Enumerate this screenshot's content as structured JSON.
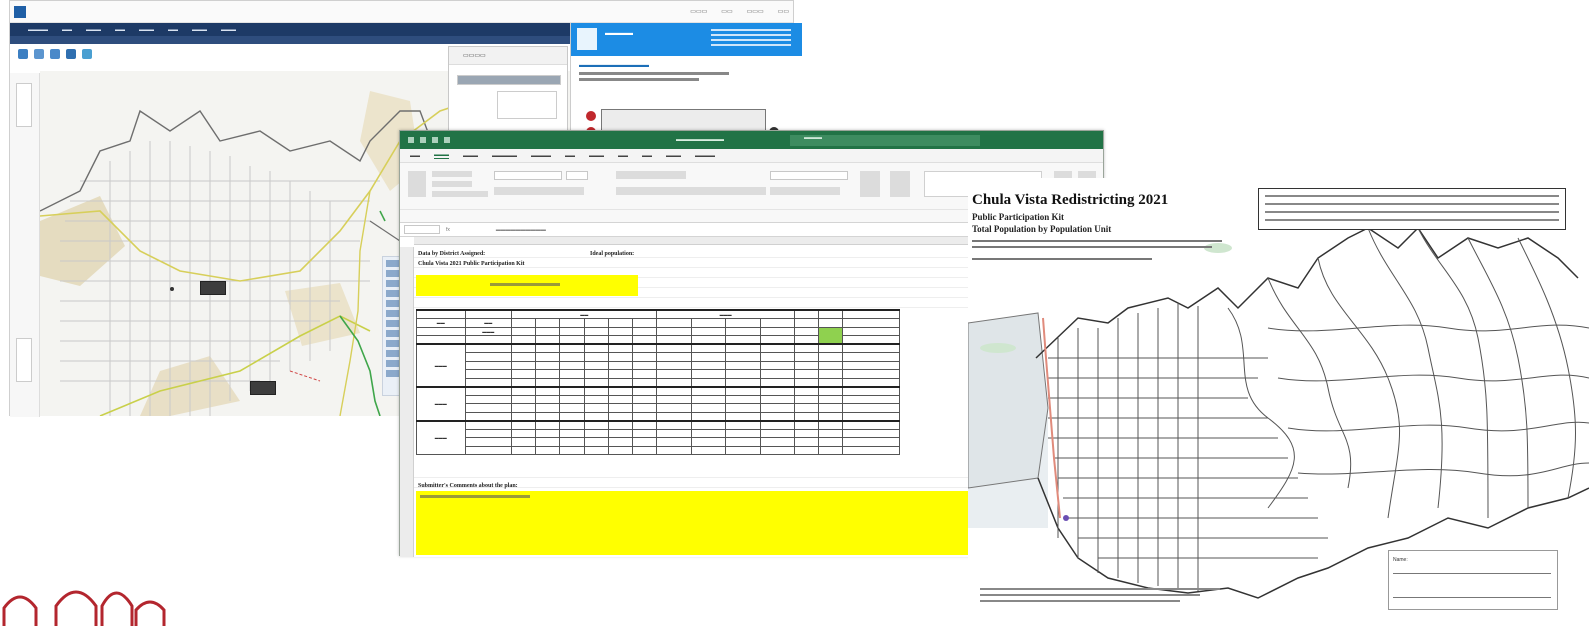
{
  "excel": {
    "header_left": "Data by District Assigned:",
    "ideal_population": "Ideal population:",
    "sheet_title": "Chula Vista 2021 Public Participation Kit",
    "comments_label": "Submitter's Comments about the plan:"
  },
  "print_map": {
    "title": "Chula Vista Redistricting 2021",
    "subtitle_1": "Public Participation Kit",
    "subtitle_2": "Total Population by Population Unit",
    "name_label": "Name:"
  },
  "colors": {
    "excel_green": "#217346",
    "highlight_yellow": "#ffff00",
    "quick_start_blue": "#1c8ce4",
    "web_nav_navy": "#1d3a66",
    "logo_red": "#b3262e"
  }
}
